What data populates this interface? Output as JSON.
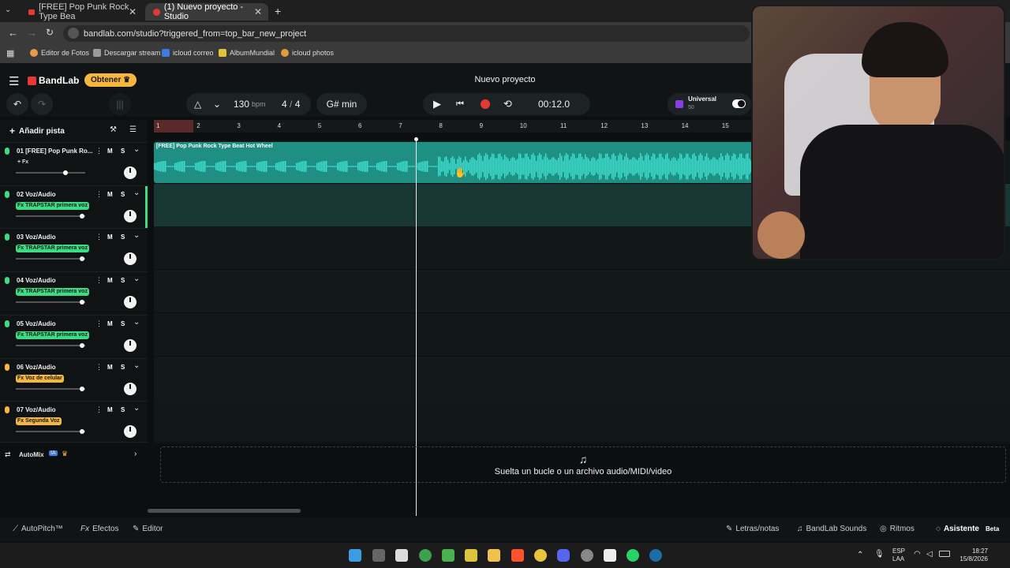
{
  "browser": {
    "tabs": [
      {
        "title": "[FREE] Pop Punk Rock Type Bea",
        "active": false
      },
      {
        "title": "(1) Nuevo proyecto - Studio",
        "active": true
      }
    ],
    "url": "bandlab.com/studio?triggered_from=top_bar_new_project",
    "bookmarks": [
      "Editor de Fotos",
      "Descargar stream",
      "icloud correo",
      "AlbumMundial",
      "icloud photos"
    ]
  },
  "app": {
    "brand": "BandLab",
    "upgrade_button": "Obtener",
    "project_title": "Nuevo proyecto",
    "bpm": "130",
    "bpm_unit": "bpm",
    "time_sig_num": "4",
    "time_sig_sep": "/",
    "time_sig_den": "4",
    "key": "G# min",
    "time": "00:12.0",
    "tuner_label": "Universal",
    "tuner_value": "50",
    "add_track": "Añadir pista",
    "drop_hint": "Suelta un bucle o un archivo audio/MIDI/video",
    "clip_title": "[FREE] Pop Punk Rock Type Beat Hot Wheel",
    "automix_label": "AutoMix",
    "automix_badge": "IA",
    "mute_label": "M",
    "solo_label": "S"
  },
  "ruler": [
    "1",
    "2",
    "3",
    "4",
    "5",
    "6",
    "7",
    "8",
    "9",
    "10",
    "11",
    "12",
    "13",
    "14",
    "15"
  ],
  "tracks": [
    {
      "number": "01",
      "name": "[FREE] Pop Punk Ro...",
      "fx": "+ Fx",
      "fx_color": "none",
      "mic_color": "#3ddc84",
      "volume": 0.72
    },
    {
      "number": "02",
      "name": "Voz/Audio",
      "fx": "Fx TRAPSTAR primera voz",
      "fx_color": "#3ddc84",
      "mic_color": "#3ddc84",
      "volume": 0.95
    },
    {
      "number": "03",
      "name": "Voz/Audio",
      "fx": "Fx TRAPSTAR primera voz",
      "fx_color": "#3ddc84",
      "mic_color": "#3ddc84",
      "volume": 0.95
    },
    {
      "number": "04",
      "name": "Voz/Audio",
      "fx": "Fx TRAPSTAR primera voz",
      "fx_color": "#3ddc84",
      "mic_color": "#3ddc84",
      "volume": 0.95
    },
    {
      "number": "05",
      "name": "Voz/Audio",
      "fx": "Fx TRAPSTAR primera voz",
      "fx_color": "#3ddc84",
      "mic_color": "#3ddc84",
      "volume": 0.95
    },
    {
      "number": "06",
      "name": "Voz/Audio",
      "fx": "Fx Voz de celular",
      "fx_color": "#f6b73c",
      "mic_color": "#f6b73c",
      "volume": 0.95
    },
    {
      "number": "07",
      "name": "Voz/Audio",
      "fx": "Fx Segunda Voz",
      "fx_color": "#f6b73c",
      "mic_color": "#f6b73c",
      "volume": 0.95
    }
  ],
  "footer": {
    "autopitch": "AutoPitch™",
    "effects": "Efectos",
    "editor": "Editor",
    "lyrics": "Letras/notas",
    "sounds": "BandLab Sounds",
    "rhythms": "Ritmos",
    "assistant": "Asistente",
    "beta": "Beta"
  },
  "taskbar": {
    "lang_top": "ESP",
    "lang_bottom": "LAA",
    "time": "18:27",
    "date": "15/8/2026"
  },
  "colors": {
    "accent_green": "#3ddc84",
    "clip": "#1f8f83",
    "waveform": "#3fe0d0",
    "record": "#e53935",
    "upgrade": "#f6b73c"
  }
}
